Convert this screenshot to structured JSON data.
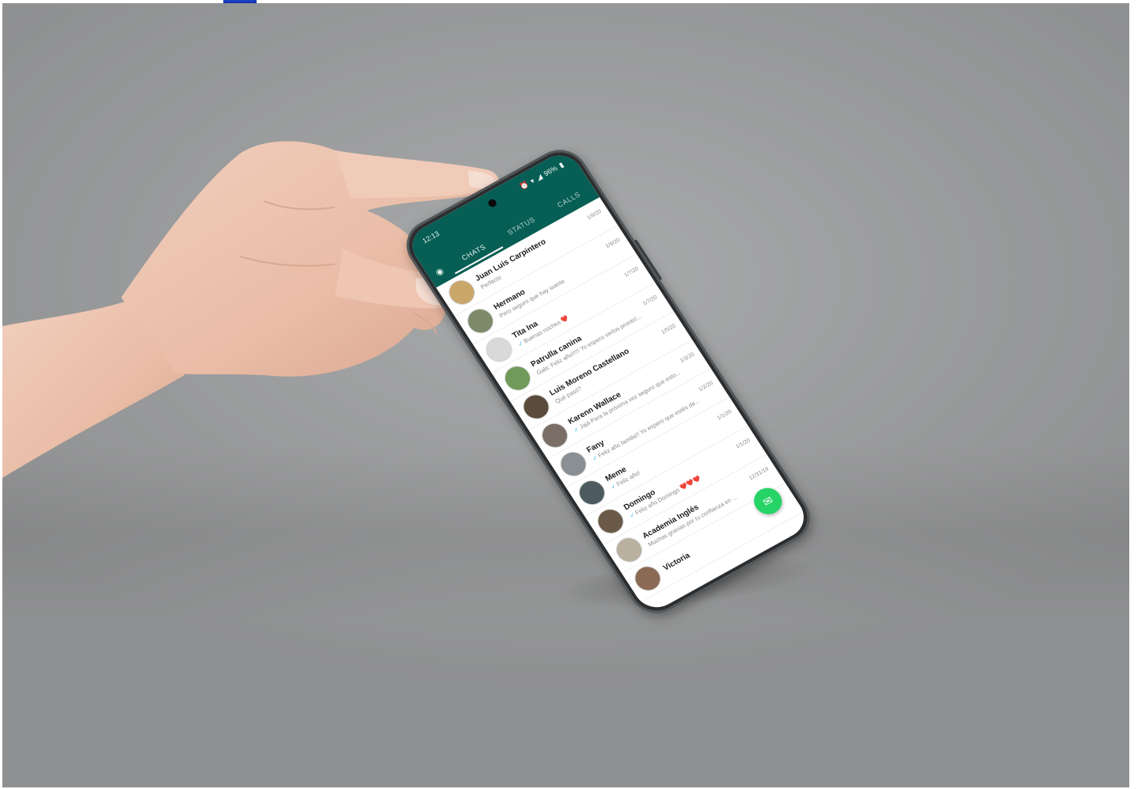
{
  "app": {
    "status_bar": {
      "time": "12:13",
      "battery": "96%"
    },
    "tabs": [
      "CHATS",
      "STATUS",
      "CALLS"
    ],
    "active_tab": "CHATS"
  },
  "chats": [
    {
      "name": "Juan Luis Carpintero",
      "message": "Perfecto",
      "time": "1/9/20",
      "read": false,
      "avatar_color": "#c9a76b"
    },
    {
      "name": "Hermano",
      "message": "Pero seguro que hay suerte",
      "time": "1/9/20",
      "read": false,
      "avatar_color": "#7d8a6a"
    },
    {
      "name": "Tita Ina",
      "message": "Buenas noches ❤️",
      "time": "1/7/20",
      "read": true,
      "avatar_color": "#d9d9d9"
    },
    {
      "name": "Patrulla canina",
      "message": "Gabi: Feliz año!!!!! Yo espero verlos pronto!...",
      "time": "1/7/20",
      "read": false,
      "avatar_color": "#6f9a5a"
    },
    {
      "name": "Luis Moreno Castellano",
      "message": "Qué pasó?",
      "time": "1/5/20",
      "read": false,
      "avatar_color": "#5b4b3a"
    },
    {
      "name": "Karenn Wallace",
      "message": "Jajá Para la próxima vez seguro que esto...",
      "time": "1/3/20",
      "read": true,
      "avatar_color": "#7a6e66"
    },
    {
      "name": "Fany",
      "message": "Feliz año familia!! Yo espero que estés de...",
      "time": "1/2/20",
      "read": true,
      "avatar_color": "#8a8f93"
    },
    {
      "name": "Meme",
      "message": "Feliz año!",
      "time": "1/1/20",
      "read": true,
      "avatar_color": "#4d5a60"
    },
    {
      "name": "Domingo",
      "message": "Feliz año Domingo ❤️❤️❤️",
      "time": "1/1/20",
      "read": true,
      "avatar_color": "#6b5a47"
    },
    {
      "name": "Academia Inglés",
      "message": "Muchas gracias por tu confianza en ...",
      "time": "12/31/19",
      "read": false,
      "avatar_color": "#b9b0a0"
    },
    {
      "name": "Victoria",
      "message": "",
      "time": "",
      "read": false,
      "avatar_color": "#8a6a55"
    }
  ],
  "colors": {
    "header": "#075e54",
    "fab": "#25d366",
    "background": "#9d9e9f"
  },
  "icons": {
    "camera": "camera-icon",
    "fab": "new-chat-icon"
  }
}
